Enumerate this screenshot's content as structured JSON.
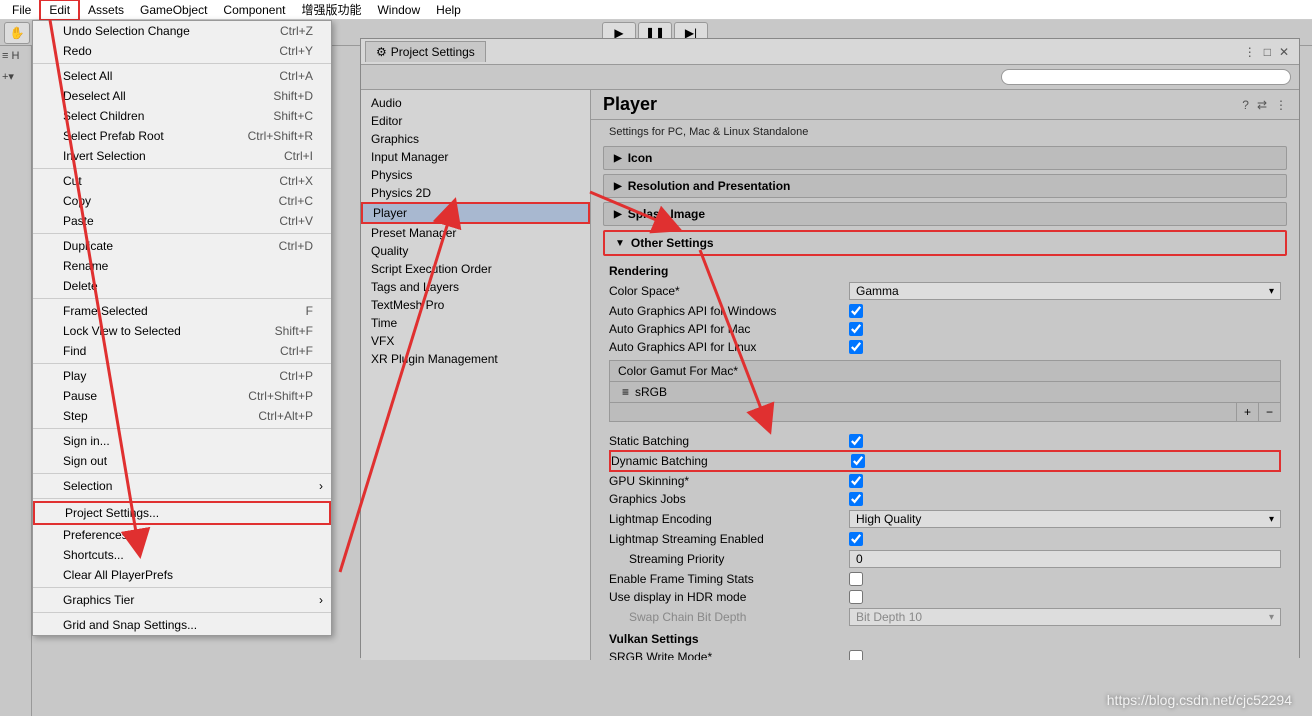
{
  "menubar": [
    "File",
    "Edit",
    "Assets",
    "GameObject",
    "Component",
    "增强版功能",
    "Window",
    "Help"
  ],
  "dropdown": {
    "groups": [
      [
        [
          "Undo Selection Change",
          "Ctrl+Z"
        ],
        [
          "Redo",
          "Ctrl+Y"
        ]
      ],
      [
        [
          "Select All",
          "Ctrl+A"
        ],
        [
          "Deselect All",
          "Shift+D"
        ],
        [
          "Select Children",
          "Shift+C"
        ],
        [
          "Select Prefab Root",
          "Ctrl+Shift+R"
        ],
        [
          "Invert Selection",
          "Ctrl+I"
        ]
      ],
      [
        [
          "Cut",
          "Ctrl+X"
        ],
        [
          "Copy",
          "Ctrl+C"
        ],
        [
          "Paste",
          "Ctrl+V"
        ]
      ],
      [
        [
          "Duplicate",
          "Ctrl+D"
        ],
        [
          "Rename",
          ""
        ],
        [
          "Delete",
          ""
        ]
      ],
      [
        [
          "Frame Selected",
          "F"
        ],
        [
          "Lock View to Selected",
          "Shift+F"
        ],
        [
          "Find",
          "Ctrl+F"
        ]
      ],
      [
        [
          "Play",
          "Ctrl+P"
        ],
        [
          "Pause",
          "Ctrl+Shift+P"
        ],
        [
          "Step",
          "Ctrl+Alt+P"
        ]
      ],
      [
        [
          "Sign in...",
          ""
        ],
        [
          "Sign out",
          ""
        ]
      ],
      [
        [
          "Selection",
          "›"
        ]
      ],
      [
        [
          "Project Settings...",
          ""
        ],
        [
          "Preferences...",
          ""
        ],
        [
          "Shortcuts...",
          ""
        ],
        [
          "Clear All PlayerPrefs",
          ""
        ]
      ],
      [
        [
          "Graphics Tier",
          "›"
        ]
      ],
      [
        [
          "Grid and Snap Settings...",
          ""
        ]
      ]
    ],
    "highlight": "Project Settings..."
  },
  "projectSettings": {
    "tab": "Project Settings",
    "searchPlaceholder": "",
    "categories": [
      "Audio",
      "Editor",
      "Graphics",
      "Input Manager",
      "Physics",
      "Physics 2D",
      "Player",
      "Preset Manager",
      "Quality",
      "Script Execution Order",
      "Tags and Layers",
      "TextMesh Pro",
      "Time",
      "VFX",
      "XR Plugin Management"
    ],
    "selected": "Player",
    "title": "Player",
    "desc": "Settings for PC, Mac & Linux Standalone",
    "sections": {
      "icon": "Icon",
      "resolution": "Resolution and Presentation",
      "splash": "Splash Image",
      "other": "Other Settings"
    },
    "rendering": {
      "hdr": "Rendering",
      "colorSpaceLabel": "Color Space*",
      "colorSpaceValue": "Gamma",
      "autoWin": "Auto Graphics API  for Windows",
      "autoMac": "Auto Graphics API  for Mac",
      "autoLinux": "Auto Graphics API  for Linux",
      "gamutHdr": "Color Gamut For Mac*",
      "gamutItem": "sRGB",
      "staticBatch": "Static Batching",
      "dynBatch": "Dynamic Batching",
      "gpuSkin": "GPU Skinning*",
      "graphicsJobs": "Graphics Jobs",
      "lmEnc": "Lightmap Encoding",
      "lmEncVal": "High Quality",
      "lmStream": "Lightmap Streaming Enabled",
      "streamPri": "Streaming Priority",
      "streamPriVal": "0",
      "frameTiming": "Enable Frame Timing Stats",
      "hdrMode": "Use display in HDR mode",
      "swapChain": "Swap Chain Bit Depth",
      "swapChainVal": "Bit Depth 10"
    },
    "vulkan": {
      "hdr": "Vulkan Settings",
      "srgb": "SRGB Write Mode*"
    }
  },
  "watermark": "https://blog.csdn.net/cjc52294"
}
